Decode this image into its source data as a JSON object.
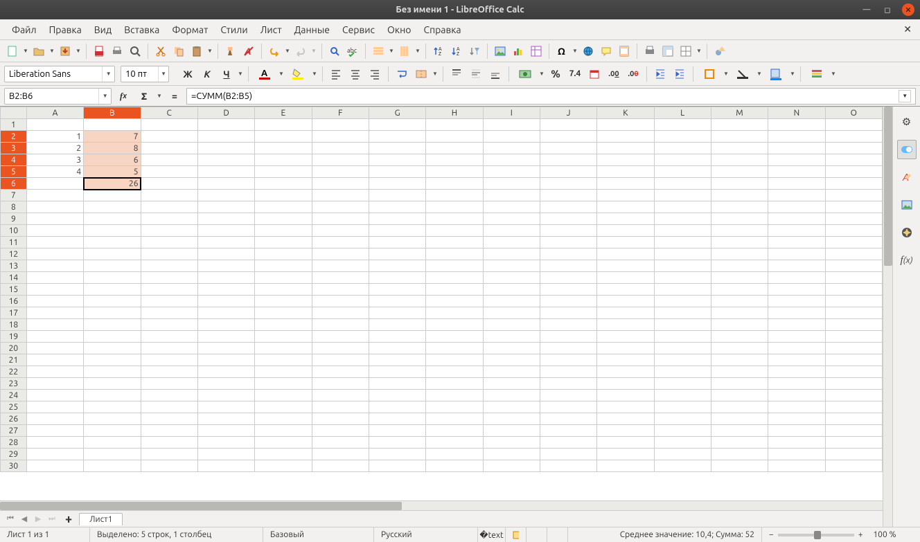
{
  "title": "Без имени 1 - LibreOffice Calc",
  "menu": [
    "Файл",
    "Правка",
    "Вид",
    "Вставка",
    "Формат",
    "Стили",
    "Лист",
    "Данные",
    "Сервис",
    "Окно",
    "Справка"
  ],
  "font_name": "Liberation Sans",
  "font_size": "10 пт",
  "name_box": "B2:B6",
  "formula": "=СУММ(B2:B5)",
  "columns": [
    "A",
    "B",
    "C",
    "D",
    "E",
    "F",
    "G",
    "H",
    "I",
    "J",
    "K",
    "L",
    "M",
    "N",
    "O"
  ],
  "row_count": 30,
  "selected_col_index": 1,
  "selected_rows": [
    2,
    3,
    4,
    5,
    6
  ],
  "cursor_cell": "B6",
  "cells": {
    "A2": "1",
    "A3": "2",
    "A4": "3",
    "A5": "4",
    "B2": "7",
    "B3": "8",
    "B4": "6",
    "B5": "5",
    "B6": "26"
  },
  "sheet_tab": "Лист1",
  "status": {
    "sheet_info": "Лист 1 из 1",
    "selection_info": "Выделено: 5 строк, 1 столбец",
    "page_style": "Базовый",
    "language": "Русский",
    "summary": "Среднее значение: 10,4; Сумма: 52",
    "zoom": "100 %"
  },
  "percent_label": "%",
  "num_label": "7.4",
  "fmt_bold": "Ж",
  "fmt_italic": "К",
  "fmt_underline": "Ч"
}
